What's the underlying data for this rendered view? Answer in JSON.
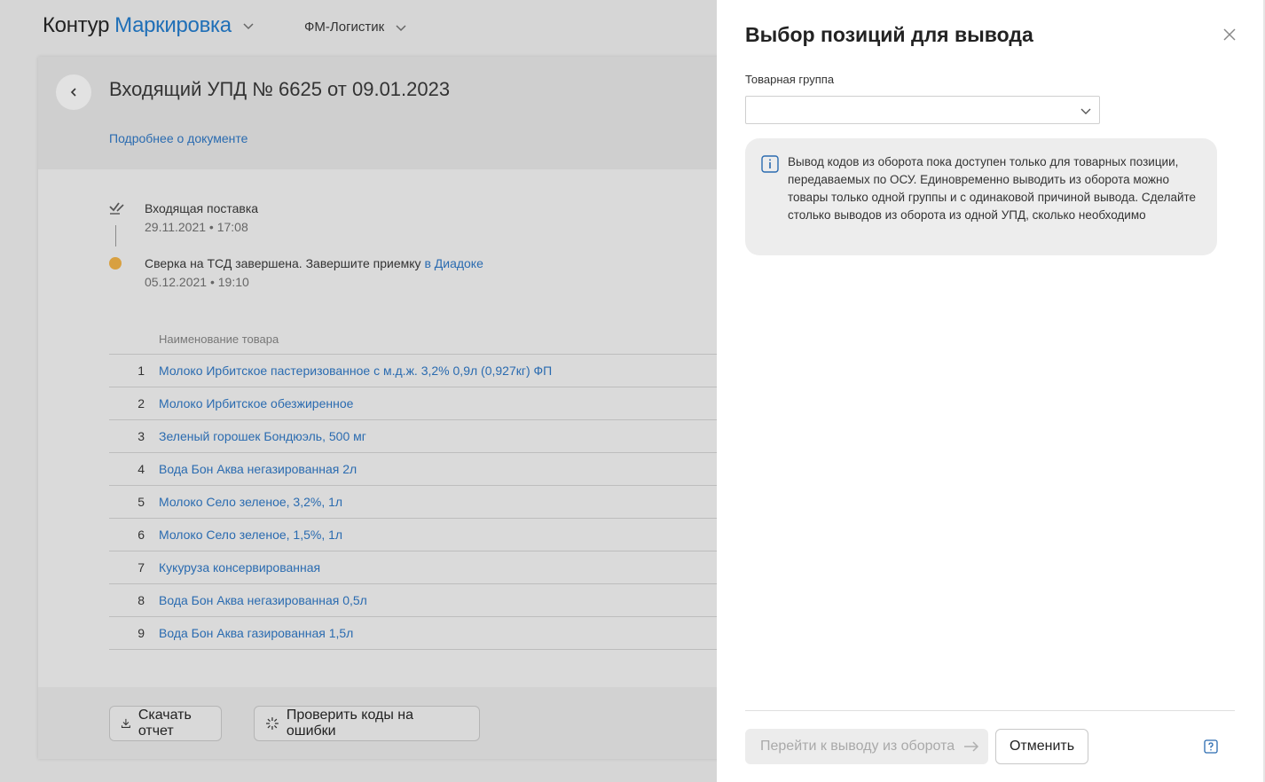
{
  "header": {
    "brand_part1": "Контур",
    "brand_part2": "Маркировка",
    "org": "ФМ-Логистик"
  },
  "document": {
    "title": "Входящий УПД № 6625 от 09.01.2023",
    "details_link": "Подробнее о документе"
  },
  "timeline": [
    {
      "title": "Входящая поставка",
      "date": "29.11.2021 • 17:08"
    },
    {
      "title": "Сверка на ТСД завершена. Завершите приемку",
      "link": "в Диадоке",
      "date": "05.12.2021 • 19:10"
    }
  ],
  "table": {
    "header_name": "Наименование товара",
    "rows": [
      {
        "num": "1",
        "name": "Молоко Ирбитское пастеризованное с м.д.ж. 3,2% 0,9л (0,927кг) ФП"
      },
      {
        "num": "2",
        "name": "Молоко Ирбитское обезжиренное"
      },
      {
        "num": "3",
        "name": "Зеленый горошек Бондюэль, 500 мг"
      },
      {
        "num": "4",
        "name": "Вода Бон Аква негазированная 2л"
      },
      {
        "num": "5",
        "name": "Молоко Село зеленое, 3,2%, 1л"
      },
      {
        "num": "6",
        "name": "Молоко Село зеленое, 1,5%, 1л"
      },
      {
        "num": "7",
        "name": "Кукуруза консервированная"
      },
      {
        "num": "8",
        "name": "Вода Бон Аква негазированная 0,5л"
      },
      {
        "num": "9",
        "name": "Вода Бон Аква газированная 1,5л"
      }
    ]
  },
  "footer": {
    "download_label": "Скачать отчет",
    "check_label": "Проверить коды на ошибки"
  },
  "panel": {
    "title": "Выбор позиций для вывода",
    "group_label": "Товарная группа",
    "group_value": "",
    "info_text": "Вывод кодов из оборота пока доступен только для товарных позиции, передаваемых по ОСУ. Единовременно выводить из оборота можно товары только одной группы и с одинаковой причиной вывода. Сделайте столько выводов из оборота из одной УПД, сколько необходимо",
    "primary_label": "Перейти к выводу из оборота",
    "cancel_label": "Отменить"
  },
  "colors": {
    "link": "#2a6bb0",
    "brand": "#1f6fb7",
    "status_dot": "#d8a040",
    "info_icon": "#2a6bb0"
  },
  "icons": {
    "close": "close-icon",
    "info": "info-icon",
    "help": "help-icon",
    "back": "chevron-left-icon",
    "download": "download-icon",
    "check": "sparkle-icon"
  }
}
